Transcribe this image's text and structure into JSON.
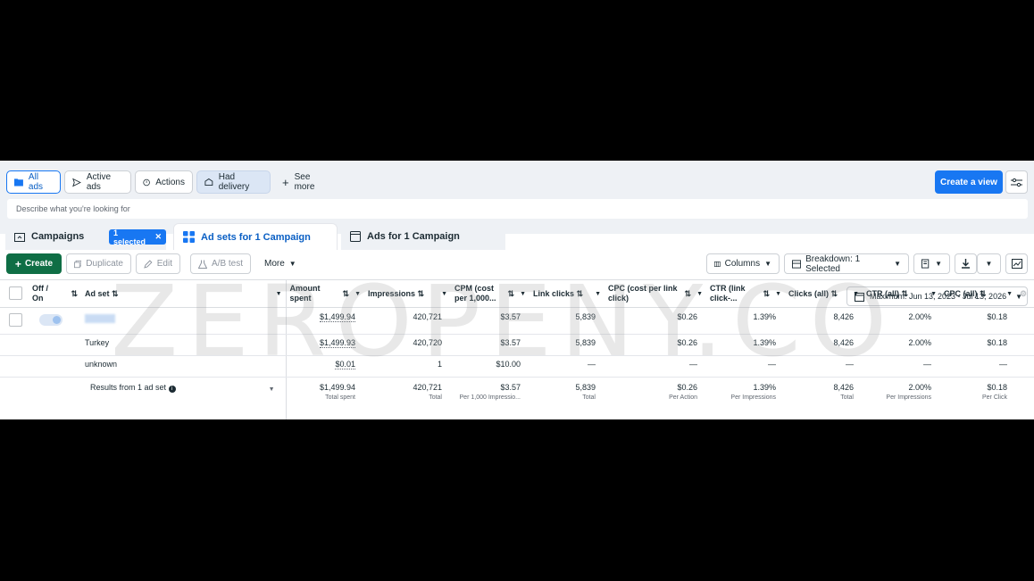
{
  "filters": {
    "all_ads": "All ads",
    "active_ads": "Active ads",
    "actions": "Actions",
    "had_delivery": "Had delivery",
    "see_more": "See more"
  },
  "create_view": "Create a view",
  "search": {
    "placeholder": "Describe what you're looking for"
  },
  "tabs": {
    "campaigns": "Campaigns",
    "selected_chip": "1 selected",
    "ad_sets": "Ad sets for 1 Campaign",
    "ads": "Ads for 1 Campaign"
  },
  "date_range": "Maximum: Jun 13, 2023 - Jul 13, 2026",
  "toolbar": {
    "create": "Create",
    "duplicate": "Duplicate",
    "edit": "Edit",
    "ab_test": "A/B test",
    "more": "More",
    "columns": "Columns",
    "breakdown": "Breakdown: 1 Selected"
  },
  "table": {
    "headers": {
      "offon": "Off / On",
      "adset": "Ad set",
      "amount": "Amount spent",
      "impressions": "Impressions",
      "cpm": "CPM (cost per 1,000...",
      "linkclicks": "Link clicks",
      "cpc_link": "CPC (cost per link click)",
      "ctr_link": "CTR (link click-...",
      "clicks_all": "Clicks (all)",
      "ctr_all": "CTR (all)",
      "cpc_all": "CPC (all)"
    },
    "rows": [
      {
        "name": "",
        "amount": "$1,499.94",
        "impressions": "420,721",
        "cpm": "$3.57",
        "linkclicks": "5,839",
        "cpc_link": "$0.26",
        "ctr_link": "1.39%",
        "clicks_all": "8,426",
        "ctr_all": "2.00%",
        "cpc_all": "$0.18"
      },
      {
        "name": "Turkey",
        "amount": "$1,499.93",
        "impressions": "420,720",
        "cpm": "$3.57",
        "linkclicks": "5,839",
        "cpc_link": "$0.26",
        "ctr_link": "1.39%",
        "clicks_all": "8,426",
        "ctr_all": "2.00%",
        "cpc_all": "$0.18"
      },
      {
        "name": "unknown",
        "amount": "$0.01",
        "impressions": "1",
        "cpm": "$10.00",
        "linkclicks": "—",
        "cpc_link": "—",
        "ctr_link": "—",
        "clicks_all": "—",
        "ctr_all": "—",
        "cpc_all": "—"
      }
    ],
    "totals": {
      "label": "Results from 1 ad set",
      "amount": "$1,499.94",
      "amount_sub": "Total spent",
      "impressions": "420,721",
      "impressions_sub": "Total",
      "cpm": "$3.57",
      "cpm_sub": "Per 1,000 Impressio...",
      "linkclicks": "5,839",
      "linkclicks_sub": "Total",
      "cpc_link": "$0.26",
      "cpc_link_sub": "Per Action",
      "ctr_link": "1.39%",
      "ctr_link_sub": "Per Impressions",
      "clicks_all": "8,426",
      "clicks_all_sub": "Total",
      "ctr_all": "2.00%",
      "ctr_all_sub": "Per Impressions",
      "cpc_all": "$0.18",
      "cpc_all_sub": "Per Click"
    }
  },
  "watermark": "ZEROPENY.CO",
  "icons": [
    "folder-icon",
    "send-icon",
    "actions-icon",
    "delivery-icon",
    "plus-icon",
    "sliders-icon",
    "calendar-icon",
    "columns-icon",
    "download-icon",
    "chart-icon",
    "sort-icon",
    "caret-down-icon",
    "info-icon"
  ]
}
